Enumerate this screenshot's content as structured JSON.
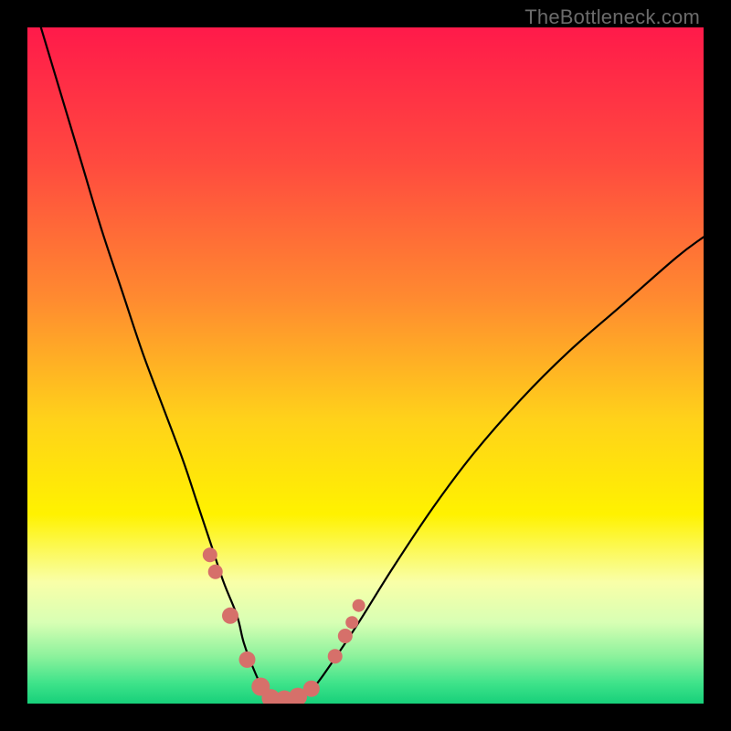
{
  "watermark": {
    "text": "TheBottleneck.com"
  },
  "chart_data": {
    "type": "line",
    "title": "",
    "xlabel": "",
    "ylabel": "",
    "xlim": [
      0,
      100
    ],
    "ylim": [
      0,
      100
    ],
    "grid": false,
    "legend": false,
    "annotations": [
      "TheBottleneck.com"
    ],
    "background_gradient_stops": [
      {
        "pos": 0.0,
        "color": "#ff1a4a"
      },
      {
        "pos": 0.2,
        "color": "#ff4a3f"
      },
      {
        "pos": 0.4,
        "color": "#ff8a30"
      },
      {
        "pos": 0.58,
        "color": "#ffd21a"
      },
      {
        "pos": 0.72,
        "color": "#fff200"
      },
      {
        "pos": 0.82,
        "color": "#f9ffa8"
      },
      {
        "pos": 0.88,
        "color": "#d8ffb4"
      },
      {
        "pos": 0.93,
        "color": "#8cf29c"
      },
      {
        "pos": 0.97,
        "color": "#3ee38a"
      },
      {
        "pos": 1.0,
        "color": "#17d07a"
      }
    ],
    "series": [
      {
        "name": "bottleneck-curve",
        "x": [
          2,
          5,
          8,
          11,
          14,
          17,
          20,
          23,
          25,
          27,
          29,
          31,
          32,
          33.5,
          35,
          37,
          39.5,
          42,
          45,
          49,
          54,
          60,
          66,
          73,
          80,
          88,
          96,
          100
        ],
        "y": [
          100,
          90,
          80,
          70,
          61,
          52,
          44,
          36,
          30,
          24,
          18,
          13,
          9,
          5,
          2,
          0.5,
          0.5,
          2,
          6,
          12,
          20,
          29,
          37,
          45,
          52,
          59,
          66,
          69
        ]
      }
    ],
    "markers": [
      {
        "x": 27.0,
        "y": 22.0,
        "r": 8
      },
      {
        "x": 27.8,
        "y": 19.5,
        "r": 8
      },
      {
        "x": 30.0,
        "y": 13.0,
        "r": 9
      },
      {
        "x": 32.5,
        "y": 6.5,
        "r": 9
      },
      {
        "x": 34.5,
        "y": 2.5,
        "r": 10
      },
      {
        "x": 36.0,
        "y": 0.8,
        "r": 10
      },
      {
        "x": 38.0,
        "y": 0.6,
        "r": 10
      },
      {
        "x": 40.0,
        "y": 1.0,
        "r": 10
      },
      {
        "x": 42.0,
        "y": 2.2,
        "r": 9
      },
      {
        "x": 45.5,
        "y": 7.0,
        "r": 8
      },
      {
        "x": 47.0,
        "y": 10.0,
        "r": 8
      },
      {
        "x": 48.0,
        "y": 12.0,
        "r": 7
      },
      {
        "x": 49.0,
        "y": 14.5,
        "r": 7
      }
    ]
  }
}
